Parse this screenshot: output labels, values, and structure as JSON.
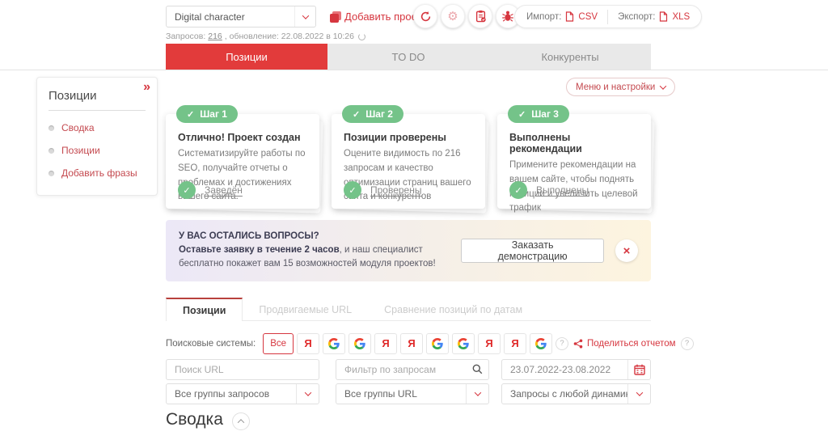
{
  "icons": {
    "check": "✓",
    "double_chevron": "»",
    "close": "×",
    "help": "?",
    "yandex_letter": "Я",
    "gear": "⚙"
  },
  "colors": {
    "accent_red": "#d6363f",
    "tab_red": "#e23b3b",
    "green": "#74c389",
    "banner_from": "#ece8f7",
    "banner_to": "#fdf4df"
  },
  "topbar": {
    "project_select_value": "Digital character",
    "add_project_label": "Добавить проект",
    "stats_queries_label": "Запросов:",
    "stats_queries_count": "216",
    "stats_rest": ", обновление: 22.08.2022 в 10:26",
    "import_label": "Импорт:",
    "import_format": "CSV",
    "export_label": "Экспорт:",
    "export_format": "XLS"
  },
  "tabs": [
    {
      "label": "Позиции",
      "active": true
    },
    {
      "label": "TO DO",
      "active": false
    },
    {
      "label": "Конкуренты",
      "active": false
    }
  ],
  "sidebar": {
    "title": "Позиции",
    "items": [
      "Сводка",
      "Позиции",
      "Добавить фразы"
    ]
  },
  "menu_settings_label": "Меню и настройки",
  "steps": [
    {
      "badge": "Шаг 1",
      "title": "Отлично! Проект создан",
      "text": "Систематизируйте работы по SEO, получайте отчеты о проблемах и достижениях вашего сайта.",
      "status": "Заведён"
    },
    {
      "badge": "Шаг 2",
      "title": "Позиции проверены",
      "text": "Оцените видимость по 216 запросам и качество оптимизации страниц вашего сайта и конкурентов",
      "status": "Проверены"
    },
    {
      "badge": "Шаг 3",
      "title": "Выполнены рекомендации",
      "text": "Примените рекомендации на вашем сайте, чтобы поднять позиции и увеличить целевой трафик",
      "status": "Выполнены"
    }
  ],
  "banner": {
    "title": "У ВАС ОСТАЛИСЬ ВОПРОСЫ?",
    "bold_text": "Оставьте заявку в течение 2 часов",
    "rest_text": ", и наш специалист бесплатно покажет вам 15 возможностей модуля проектов!",
    "button_label": "Заказать демонстрацию"
  },
  "subtabs": [
    {
      "label": "Позиции",
      "active": true
    },
    {
      "label": "Продвигаемые URL",
      "active": false
    },
    {
      "label": "Сравнение позиций по датам",
      "active": false
    }
  ],
  "filters": {
    "search_engines_label": "Поисковые системы:",
    "all_button_label": "Все",
    "engines": [
      "yandex",
      "google",
      "google",
      "yandex",
      "yandex",
      "google",
      "google",
      "yandex",
      "yandex",
      "google"
    ],
    "share_report_label": "Поделиться отчетом",
    "search_url_placeholder": "Поиск URL",
    "query_filter_placeholder": "Фильтр по запросам",
    "date_range_value": "23.07.2022-23.08.2022",
    "query_groups_value": "Все группы запросов",
    "url_groups_value": "Все группы URL",
    "dynamics_value": "Запросы с любой динамикой"
  },
  "summary_heading": "Сводка"
}
